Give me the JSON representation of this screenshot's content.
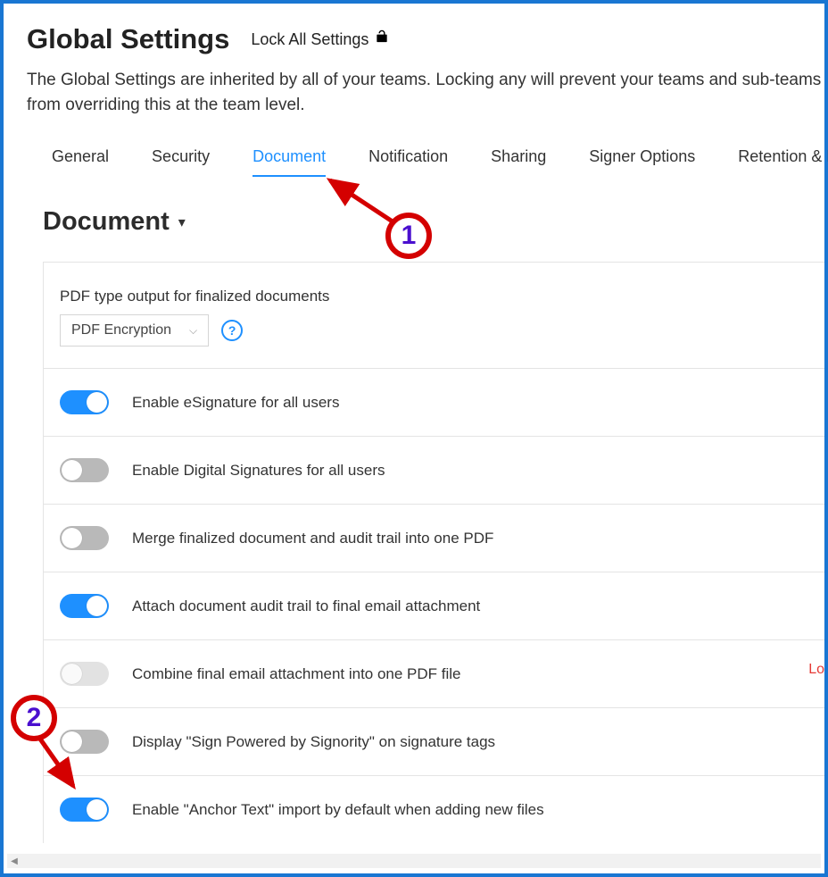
{
  "header": {
    "title": "Global Settings",
    "lock_all_label": "Lock All Settings"
  },
  "description": "The Global Settings are inherited by all of your teams. Locking any will prevent your teams and sub-teams from overriding this at the team level.",
  "tabs": {
    "general": "General",
    "security": "Security",
    "document": "Document",
    "notification": "Notification",
    "sharing": "Sharing",
    "signer_options": "Signer Options",
    "retention": "Retention & E"
  },
  "section": {
    "heading": "Document"
  },
  "pdf": {
    "label": "PDF type output for finalized documents",
    "selected": "PDF Encryption",
    "help": "?"
  },
  "toggles": {
    "esignature": "Enable eSignature for all users",
    "digital_signatures": "Enable Digital Signatures for all users",
    "merge_audit": "Merge finalized document and audit trail into one PDF",
    "attach_audit": "Attach document audit trail to final email attachment",
    "combine_email": "Combine final email attachment into one PDF file",
    "combine_locked": "Lo",
    "sign_powered": "Display \"Sign Powered by Signority\" on signature tags",
    "anchor_text": "Enable \"Anchor Text\" import by default when adding new files"
  },
  "annotations": {
    "one": "1",
    "two": "2"
  }
}
